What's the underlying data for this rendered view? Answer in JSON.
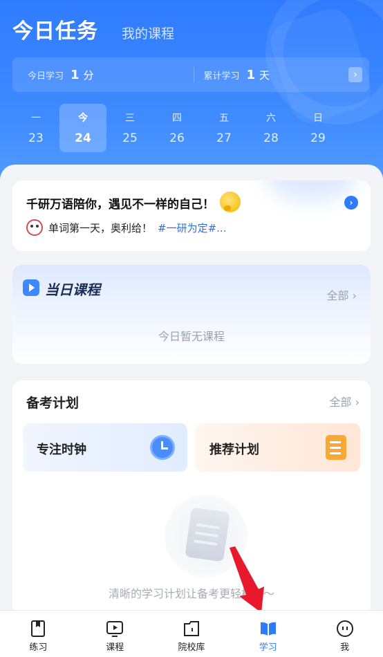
{
  "header": {
    "title": "今日任务",
    "subtitle_tab": "我的课程",
    "today_study": {
      "label": "今日学习",
      "value": "1",
      "unit": "分"
    },
    "total_study": {
      "label": "累计学习",
      "value": "1",
      "unit": "天"
    },
    "more_arrow": "›"
  },
  "week": [
    {
      "name": "一",
      "date": "23"
    },
    {
      "name": "今",
      "date": "24",
      "active": true
    },
    {
      "name": "三",
      "date": "25"
    },
    {
      "name": "四",
      "date": "26"
    },
    {
      "name": "五",
      "date": "27"
    },
    {
      "name": "六",
      "date": "28"
    },
    {
      "name": "日",
      "date": "29"
    }
  ],
  "motto": {
    "title": "千研万语陪你，遇见不一样的自己！",
    "line": "单词第一天，奥利给！",
    "tag": "#一研为定#...",
    "go": "›"
  },
  "course": {
    "title": "当日课程",
    "all": "全部 ›",
    "empty": "今日暂无课程"
  },
  "plan": {
    "title": "备考计划",
    "all": "全部 ›",
    "focus_label": "专注时钟",
    "recommend_label": "推荐计划",
    "empty_text": "清晰的学习计划让备考更轻松哦～"
  },
  "tabs": [
    {
      "label": "练习",
      "icon": "practice-book-icon"
    },
    {
      "label": "课程",
      "icon": "video-course-icon"
    },
    {
      "label": "院校库",
      "icon": "school-folder-icon"
    },
    {
      "label": "学习",
      "icon": "open-book-icon",
      "active": true
    },
    {
      "label": "我",
      "icon": "chat-face-icon"
    }
  ],
  "colors": {
    "accent": "#2f7bff",
    "tab_active": "#2f7bff",
    "arrow": "#e8192c"
  }
}
